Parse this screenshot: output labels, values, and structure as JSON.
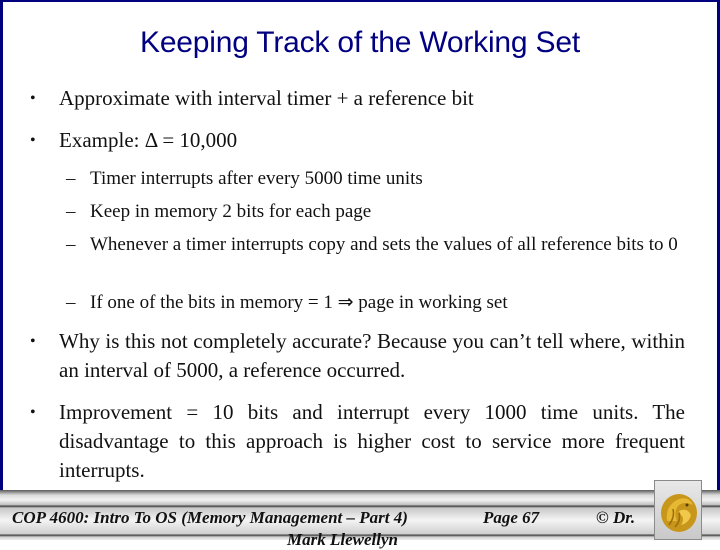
{
  "slide": {
    "title": "Keeping Track of the Working Set",
    "bullets": [
      {
        "marker": "•",
        "text": "Approximate with interval timer + a reference bit"
      },
      {
        "marker": "•",
        "text": "Example: Δ = 10,000"
      },
      {
        "marker": "•",
        "text": "Why is this not completely accurate?  Because you can’t tell where, within an interval of 5000, a reference occurred."
      },
      {
        "marker": "•",
        "text": "Improvement = 10 bits and interrupt every 1000 time units.  The disadvantage to this approach is higher cost to service more frequent interrupts."
      }
    ],
    "sub_bullets": [
      {
        "marker": "–",
        "text": "Timer interrupts after every 5000 time units"
      },
      {
        "marker": "–",
        "text": "Keep in memory 2 bits for each page"
      },
      {
        "marker": "–",
        "text": "Whenever a timer interrupts copy and sets the values of all reference bits to 0"
      },
      {
        "marker": "–",
        "text": "If one of the bits in memory = 1 ⇒ page in working set"
      }
    ]
  },
  "footer": {
    "course": "COP 4600: Intro To OS  (Memory Management – Part 4)",
    "page": "Page 67",
    "copyright": "© Dr.",
    "author_cut": "Mark Llewellyn",
    "logo_icon": "pegasus-logo-icon"
  },
  "colors": {
    "title": "#000080",
    "border": "#00007f",
    "logo_gold": "#d4a017"
  }
}
